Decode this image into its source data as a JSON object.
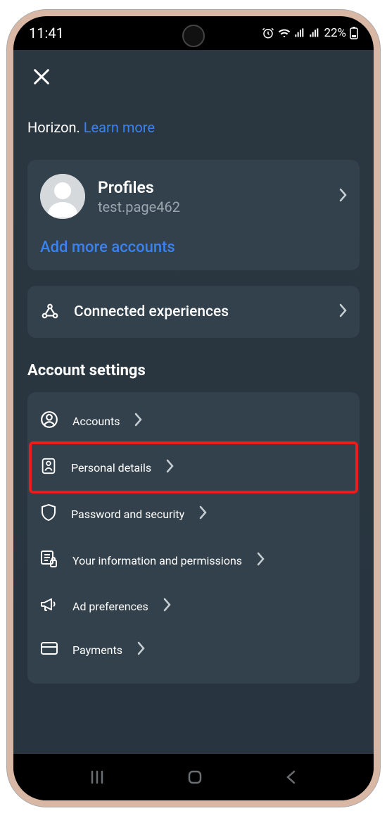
{
  "status": {
    "time": "11:41",
    "battery_text": "22%"
  },
  "header": {
    "horizon_text": "Horizon.",
    "learn_more": "Learn more"
  },
  "profile_card": {
    "title": "Profiles",
    "username": "test.page462",
    "add_more": "Add more accounts"
  },
  "connected": {
    "label": "Connected experiences"
  },
  "section_title": "Account settings",
  "settings": [
    {
      "key": "accounts",
      "label": "Accounts",
      "highlighted": false
    },
    {
      "key": "personal-details",
      "label": "Personal details",
      "highlighted": true
    },
    {
      "key": "password-security",
      "label": "Password and security",
      "highlighted": false
    },
    {
      "key": "info-permissions",
      "label": "Your information and permissions",
      "highlighted": false
    },
    {
      "key": "ad-preferences",
      "label": "Ad preferences",
      "highlighted": false
    },
    {
      "key": "payments",
      "label": "Payments",
      "highlighted": false
    }
  ]
}
